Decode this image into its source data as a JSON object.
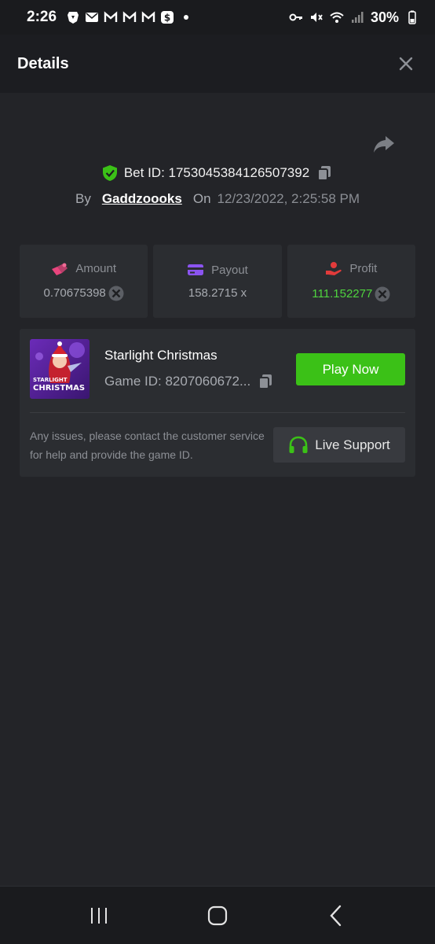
{
  "status_bar": {
    "time": "2:26",
    "battery": "30%",
    "left_icons": [
      "brave-icon",
      "mail-icon",
      "gmail-icon",
      "gmail-icon",
      "gmail-icon",
      "cashapp-icon",
      "dot-icon"
    ],
    "right_icons": [
      "key-icon",
      "mute-icon",
      "wifi-icon",
      "signal-icon",
      "battery-icon"
    ]
  },
  "header": {
    "title": "Details"
  },
  "bet": {
    "bet_id_text": "Bet ID: 1753045384126507392",
    "by_label": "By",
    "username": "Gaddzoooks",
    "on_label": "On",
    "date": "12/23/2022, 2:25:58 PM"
  },
  "stats": [
    {
      "label": "Amount",
      "value": "0.70675398",
      "icon": "amount-icon",
      "icon_color": "#e8457d"
    },
    {
      "label": "Payout",
      "value": "158.2715 x",
      "icon": "payout-card-icon",
      "icon_color": "#8b54f0"
    },
    {
      "label": "Profit",
      "value": "111.152277",
      "icon": "profit-hand-icon",
      "icon_color": "#e23b3b"
    }
  ],
  "game": {
    "name": "Starlight Christmas",
    "game_id": "Game ID: 8207060672...",
    "play_label": "Play Now",
    "thumb_text_1": "STARLIGHT",
    "thumb_text_2": "CHRISTMAS",
    "help_text": "Any issues, please contact the customer service for help and provide the game ID.",
    "support_label": "Live Support"
  },
  "colors": {
    "accent_green": "#3bc117",
    "profit_green": "#4fd43e",
    "background": "#232428",
    "card": "#2b2d31"
  }
}
